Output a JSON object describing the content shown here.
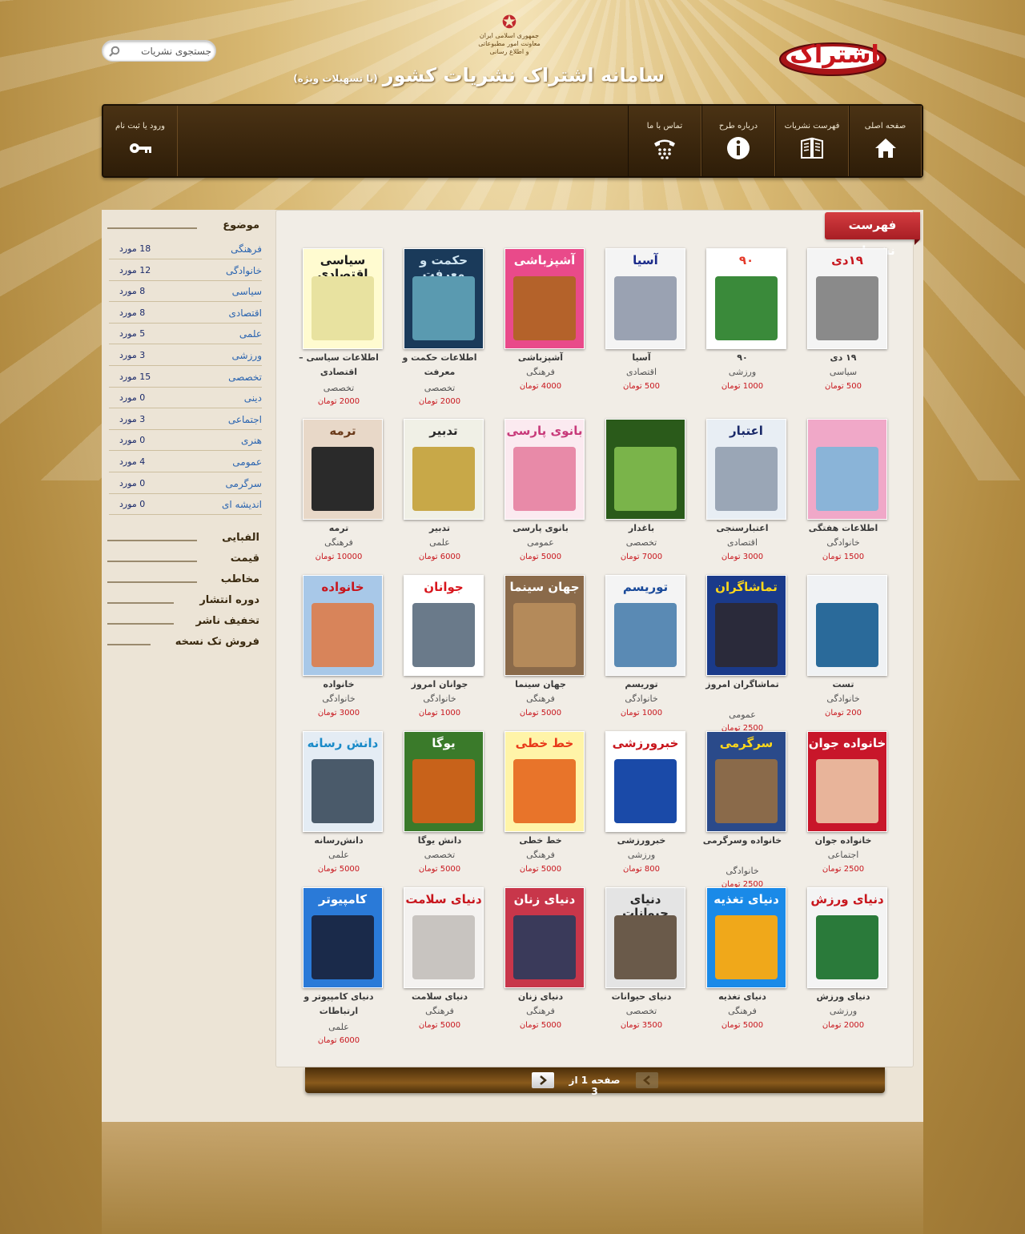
{
  "header": {
    "logo_text": "اشتراک",
    "emblem_lines": [
      "جمهوری اسلامی ایران",
      "معاونت امور مطبوعاتی و اطلاع رسانی"
    ],
    "site_title": "سامانه اشتراک نشریات کشور",
    "site_subtitle": "(با تسهیلات ویژه)",
    "search_placeholder": "جستجوی نشریات"
  },
  "nav": {
    "home": "صفحه اصلی",
    "catalog": "فهرست نشریات",
    "about": "درباره طرح",
    "contact": "تماس با ما",
    "login": "ورود یا ثبت نام"
  },
  "ribbon": "فهرست نشریات",
  "sidebar": {
    "topic_header": "موضوع",
    "topics": [
      {
        "name": "فرهنگی",
        "count": "18 مورد"
      },
      {
        "name": "خانوادگی",
        "count": "12 مورد"
      },
      {
        "name": "سیاسی",
        "count": "8 مورد"
      },
      {
        "name": "اقتصادی",
        "count": "8 مورد"
      },
      {
        "name": "علمی",
        "count": "5 مورد"
      },
      {
        "name": "ورزشی",
        "count": "3 مورد"
      },
      {
        "name": "تخصصی",
        "count": "15 مورد"
      },
      {
        "name": "دینی",
        "count": "0 مورد"
      },
      {
        "name": "اجتماعی",
        "count": "3 مورد"
      },
      {
        "name": "هنری",
        "count": "0 مورد"
      },
      {
        "name": "عمومی",
        "count": "4 مورد"
      },
      {
        "name": "سرگرمی",
        "count": "0 مورد"
      },
      {
        "name": "اندیشه ای",
        "count": "0 مورد"
      }
    ],
    "filters": [
      "الفبایی",
      "قیمت",
      "مخاطب",
      "دوره انتشار",
      "تخفیف ناشر",
      "فروش تک نسخه"
    ]
  },
  "publications": [
    {
      "name": "۱۹ دی",
      "cat": "سیاسی",
      "price": "500 تومان",
      "cover": "۱۹دی",
      "bg": "#f4f4f4",
      "fg": "#c8161d",
      "pic": "#8a8a8a"
    },
    {
      "name": "۹۰",
      "cat": "ورزشی",
      "price": "1000 تومان",
      "cover": "۹۰",
      "bg": "#ffffff",
      "fg": "#e43a2a",
      "pic": "#3a8a3a"
    },
    {
      "name": "آسیا",
      "cat": "اقتصادی",
      "price": "500 تومان",
      "cover": "آسیا",
      "bg": "#f4f4f4",
      "fg": "#1a2a8a",
      "pic": "#9aa2b2"
    },
    {
      "name": "آشپزباشی",
      "cat": "فرهنگی",
      "price": "4000 تومان",
      "cover": "آشپزباشی",
      "bg": "#e94a8a",
      "fg": "#ffffff",
      "pic": "#b4622a"
    },
    {
      "name": "اطلاعات حکمت و معرفت",
      "cat": "تخصصی",
      "price": "2000 تومان",
      "cover": "حکمت و معرفت",
      "bg": "#1a3a5a",
      "fg": "#cfe4f0",
      "pic": "#5a9ab0"
    },
    {
      "name": "اطلاعات سیاسی – اقتصادی",
      "cat": "تخصصی",
      "price": "2000 تومان",
      "cover": "سیاسی اقتصادی",
      "bg": "#fffbd0",
      "fg": "#1a1a1a",
      "pic": "#e8e2a0"
    },
    {
      "name": "اطلاعات هفتگی",
      "cat": "خانوادگی",
      "price": "1500 تومان",
      "cover": "",
      "bg": "#f0a8c8",
      "fg": "#ffffff",
      "pic": "#8ab4d8"
    },
    {
      "name": "اعتبارسنجی",
      "cat": "اقتصادی",
      "price": "3000 تومان",
      "cover": "اعتبار",
      "bg": "#e8eef4",
      "fg": "#1a2a6a",
      "pic": "#9aa6b6"
    },
    {
      "name": "باغدار",
      "cat": "تخصصی",
      "price": "7000 تومان",
      "cover": "",
      "bg": "#2a5a1a",
      "fg": "#ffffff",
      "pic": "#7ab44a"
    },
    {
      "name": "بانوی پارسی",
      "cat": "عمومی",
      "price": "5000 تومان",
      "cover": "بانوی پارسی",
      "bg": "#fbeaf0",
      "fg": "#c83a7a",
      "pic": "#e88aa8"
    },
    {
      "name": "تدبیر",
      "cat": "علمی",
      "price": "6000 تومان",
      "cover": "تدبیر",
      "bg": "#f0f0e6",
      "fg": "#2a2a2a",
      "pic": "#c8a848"
    },
    {
      "name": "ترمه",
      "cat": "فرهنگی",
      "price": "10000 تومان",
      "cover": "ترمه",
      "bg": "#e8d8c8",
      "fg": "#6a3a1a",
      "pic": "#2a2a2a"
    },
    {
      "name": "تست",
      "cat": "خانوادگی",
      "price": "200 تومان",
      "cover": "",
      "bg": "#f0f2f4",
      "fg": "#1a4a8a",
      "pic": "#2a6a9a"
    },
    {
      "name": "تماشاگران امروز",
      "cat": "عمومی",
      "price": "2500 تومان",
      "cover": "تماشاگران",
      "bg": "#1a3a8a",
      "fg": "#ffd81a",
      "pic": "#2a2a3a"
    },
    {
      "name": "توریسم",
      "cat": "خانوادگی",
      "price": "1000 تومان",
      "cover": "توریسم",
      "bg": "#f4f4f4",
      "fg": "#1a4a9a",
      "pic": "#5a8ab4"
    },
    {
      "name": "جهان سینما",
      "cat": "فرهنگی",
      "price": "5000 تومان",
      "cover": "جهان سینما",
      "bg": "#8a6a4a",
      "fg": "#ffffff",
      "pic": "#b48a5a"
    },
    {
      "name": "جوانان امروز",
      "cat": "خانوادگی",
      "price": "1000 تومان",
      "cover": "جوانان",
      "bg": "#ffffff",
      "fg": "#d8161d",
      "pic": "#6a7a8a"
    },
    {
      "name": "خانواده",
      "cat": "خانوادگی",
      "price": "3000 تومان",
      "cover": "خانواده",
      "bg": "#a8c8e8",
      "fg": "#c8161d",
      "pic": "#d8845a"
    },
    {
      "name": "خانواده جوان",
      "cat": "اجتماعی",
      "price": "2500 تومان",
      "cover": "خانواده جوان",
      "bg": "#c8162a",
      "fg": "#ffffff",
      "pic": "#e8b49a"
    },
    {
      "name": "خانواده وسرگرمی",
      "cat": "خانوادگی",
      "price": "2500 تومان",
      "cover": "سرگرمی",
      "bg": "#2a4a8a",
      "fg": "#ffd81a",
      "pic": "#8a6a4a"
    },
    {
      "name": "خبرورزشی",
      "cat": "ورزشی",
      "price": "800 تومان",
      "cover": "خبرورزشی",
      "bg": "#ffffff",
      "fg": "#c8161d",
      "pic": "#1a4aa8"
    },
    {
      "name": "خط خطی",
      "cat": "فرهنگی",
      "price": "5000 تومان",
      "cover": "خط خطی",
      "bg": "#fff4a8",
      "fg": "#e83a1a",
      "pic": "#e8742a"
    },
    {
      "name": "دانش یوگا",
      "cat": "تخصصی",
      "price": "5000 تومان",
      "cover": "یوگا",
      "bg": "#3a7a2a",
      "fg": "#ffffff",
      "pic": "#c8621a"
    },
    {
      "name": "دانش‌رسانه",
      "cat": "علمی",
      "price": "5000 تومان",
      "cover": "دانش رسانه",
      "bg": "#e4ecf4",
      "fg": "#1a8ac8",
      "pic": "#4a5a6a"
    },
    {
      "name": "دنیای ورزش",
      "cat": "ورزشی",
      "price": "2000 تومان",
      "cover": "دنیای ورزش",
      "bg": "#f4f4f4",
      "fg": "#c8161d",
      "pic": "#2a7a3a"
    },
    {
      "name": "دنیای تغذیه",
      "cat": "فرهنگی",
      "price": "5000 تومان",
      "cover": "دنیای تغذیه",
      "bg": "#1a8ae8",
      "fg": "#ffffff",
      "pic": "#f0a81a"
    },
    {
      "name": "دنیای حیوانات",
      "cat": "تخصصی",
      "price": "3500 تومان",
      "cover": "دنیای حیوانات",
      "bg": "#e4e4e4",
      "fg": "#2a2a2a",
      "pic": "#6a5a4a"
    },
    {
      "name": "دنیای زنان",
      "cat": "فرهنگی",
      "price": "5000 تومان",
      "cover": "دنیای زنان",
      "bg": "#c8364a",
      "fg": "#ffffff",
      "pic": "#3a3a5a"
    },
    {
      "name": "دنیای سلامت",
      "cat": "فرهنگی",
      "price": "5000 تومان",
      "cover": "دنیای سلامت",
      "bg": "#f4f2f0",
      "fg": "#c8161d",
      "pic": "#c8c4c0"
    },
    {
      "name": "دنیای کامپیوتر و ارتباطات",
      "cat": "علمی",
      "price": "6000 تومان",
      "cover": "کامپیوتر",
      "bg": "#2a7ad8",
      "fg": "#ffffff",
      "pic": "#1a2a4a"
    }
  ],
  "pager": {
    "text": "صفحه 1 از 3"
  }
}
